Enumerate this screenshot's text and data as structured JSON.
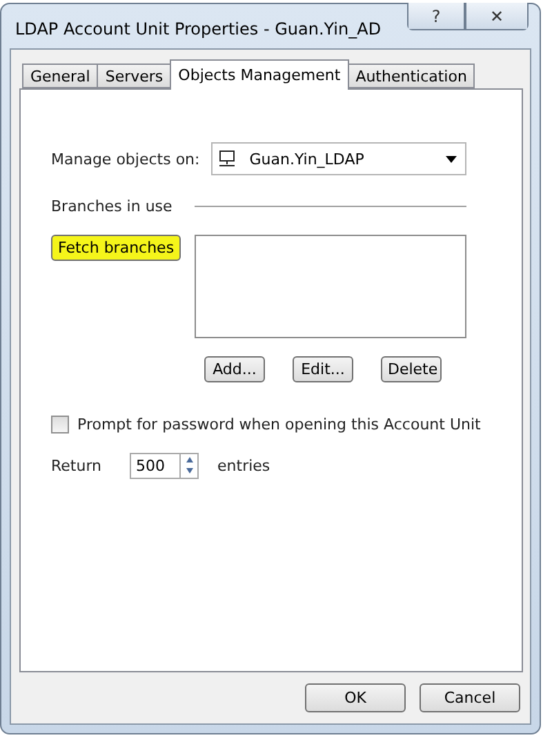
{
  "window": {
    "title": "LDAP Account Unit Properties - Guan.Yin_AD",
    "help_button": "?",
    "close_button": "✕"
  },
  "tabs": [
    {
      "label": "General",
      "selected": false
    },
    {
      "label": "Servers",
      "selected": false
    },
    {
      "label": "Objects Management",
      "selected": true
    },
    {
      "label": "Authentication",
      "selected": false
    }
  ],
  "manage_objects": {
    "label": "Manage objects on:",
    "value": "Guan.Yin_LDAP"
  },
  "branches": {
    "heading": "Branches in use",
    "fetch_button": {
      "label": "Fetch branches",
      "highlighted": true
    },
    "buttons": [
      "Add...",
      "Edit...",
      "Delete"
    ]
  },
  "prompt_checkbox": {
    "label": "Prompt for password when opening this Account Unit",
    "checked": false
  },
  "return_entries": {
    "label": "Return",
    "value": "500",
    "suffix": "entries"
  },
  "dialog_buttons": [
    "OK",
    "Cancel"
  ]
}
